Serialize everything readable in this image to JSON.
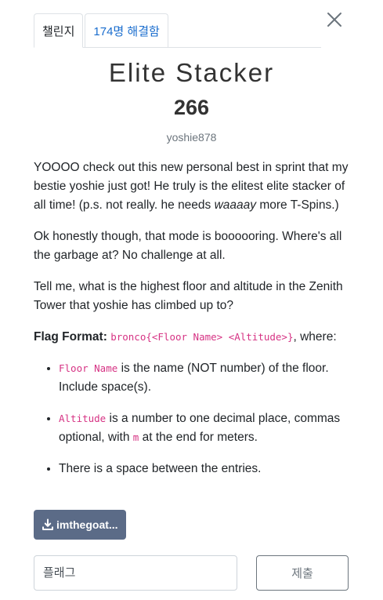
{
  "tabs": {
    "challenge": "챌린지",
    "solves": "174명 해결함"
  },
  "challenge": {
    "name": "Elite Stacker",
    "points": "266",
    "author": "yoshie878"
  },
  "description": {
    "p1_part1": "YOOOO check out this new personal best in sprint that my bestie yoshie just got! He truly is the elitest elite stacker of all time! (p.s. not really. he needs ",
    "p1_emphasis": "waaaay",
    "p1_part2": " more T-Spins.)",
    "p2": "Ok honestly though, that mode is boooooring. Where's all the garbage at? No challenge at all.",
    "p3": "Tell me, what is the highest floor and altitude in the Zenith Tower that yoshie has climbed up to?",
    "format_label": "Flag Format:",
    "format_code": "bronco{<Floor Name> <Altitude>}",
    "format_suffix": ", where:",
    "bullets": [
      {
        "code": "Floor Name",
        "text": " is the name (NOT number) of the floor. Include space(s)."
      },
      {
        "code": "Altitude",
        "text_before": " is a number to one decimal place, commas optional, with ",
        "code2": "m",
        "text_after": " at the end for meters."
      },
      {
        "text": "There is a space between the entries."
      }
    ]
  },
  "file": {
    "label": "imthegoat..."
  },
  "form": {
    "flag_placeholder": "플래그",
    "submit_label": "제출"
  },
  "colors": {
    "tab_link": "#1a6dce",
    "code": "#d63384",
    "file_button": "#5b6b87",
    "submit_border": "#6c757d"
  },
  "icons": {
    "close": "close-icon",
    "download": "download-icon"
  }
}
